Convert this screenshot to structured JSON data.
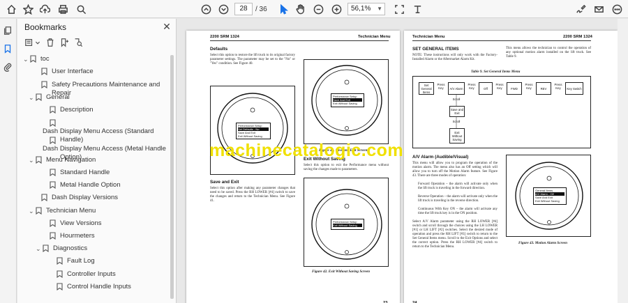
{
  "toolbar": {
    "page_current": "28",
    "page_total": "/ 36",
    "zoom": "56,1%"
  },
  "panel": {
    "title": "Bookmarks",
    "items": [
      {
        "label": "toc"
      },
      {
        "label": "User Interface"
      },
      {
        "label": "Safety Precautions Maintenance and Repair"
      },
      {
        "label": "General"
      },
      {
        "label": "Description"
      },
      {
        "label": "Dash Display Menu Access (Standard"
      },
      {
        "label": "Handle)"
      },
      {
        "label": "Dash Display Menu Access (Metal Handle"
      },
      {
        "label": "Option)"
      },
      {
        "label": "Menu Navigation"
      },
      {
        "label": "Standard Handle"
      },
      {
        "label": "Metal Handle Option"
      },
      {
        "label": "Dash Display Versions"
      },
      {
        "label": "Technician Menu"
      },
      {
        "label": "View Versions"
      },
      {
        "label": "Hourmeters"
      },
      {
        "label": "Diagnostics"
      },
      {
        "label": "Fault Log"
      },
      {
        "label": "Controller Inputs"
      },
      {
        "label": "Control Handle Inputs"
      }
    ]
  },
  "left_page": {
    "header_left": "2200 SRM 1324",
    "header_right": "Technician Menu",
    "h_defaults": "Defaults",
    "p_defaults": "Select this option to restore the lift truck to its original factory parameter settings. The parameter may be set to the \"No\" or \"Yes\" condition. See Figure 40.",
    "fig40_screen": [
      "Performance Setup",
      "Set Defaults - No",
      "Save And Exit",
      "Exit Without Saving"
    ],
    "fig41_screen": [
      "Performance Setup",
      "Save And Exit",
      "Exit Without Saving"
    ],
    "fig41_caption": "Figure 41. Save and Exit Screen",
    "h_exit": "Exit Without Saving",
    "p_exit": "Select this option to exit the Performance menu without saving the changes made to parameters.",
    "h_save": "Save and Exit",
    "p_save": "Select this option after making any parameter changes that need to be saved. Press the RH LOWER [#4] switch to save the changes and return to the Technician Menu. See Figure 41.",
    "fig42_screen": [
      "Performance Setup",
      "Exit Without Saving"
    ],
    "fig42_caption": "Figure 42. Exit Without Saving Screen",
    "footer": "23"
  },
  "right_page": {
    "header_left": "Technician Menu",
    "header_right": "2200 SRM 1324",
    "h_set": "SET GENERAL ITEMS",
    "note": "NOTE: These instructions will only work with the Factory-Installed Alarm or the Aftermarket Alarm Kit.",
    "p_set": "This menu allows the technician to control the operation of any optional motion alarm installed on the lift truck. See Table 9.",
    "table_title": "Table 9. Set General Items Menu",
    "table_boxes": [
      "Set General Items",
      "A/V Alarm",
      "Off",
      "FWD",
      "REV",
      "Key Switch",
      "Save and Exit",
      "Exit Without Saving"
    ],
    "table_labels": [
      "Press Key",
      "Press Key",
      "Press Key",
      "Press Key",
      "Press Key",
      "Scroll",
      "Scroll"
    ],
    "h_av": "A/V Alarm (Audible/Visual)",
    "p_av": "This menu will allow you to program the operation of the motion alarm. The menu also has an Off setting which will allow you to turn off the Motion Alarm feature. See Figure 43. There are three modes of operation:",
    "p_fwd": "Forward Operation – the alarm will activate only when the lift truck is traveling in the forward direction.",
    "p_rev": "Reverse Operation – the alarm will activate only when the lift truck is traveling in the reverse direction.",
    "p_cont": "Continuous With Key ON – the alarm will activate any time the lift truck key is in the ON position.",
    "p_select": "Select A/V Alarm parameter using the RH LOWER [#4] switch and scroll through the choices using the LH LOWER [#1] or LH LIFT [#2] switches. Select the desired mode of operation and press the RH LIFT [#3] switch to return to the Set General Items menu. Scroll to the Exit Options and select the correct option. Press the RH LOWER [#4] switch to return to the Technician Menu.",
    "fig43_screen": [
      "General Items",
      "A/V Alarm - Off",
      "Save And Exit",
      "Exit Without Saving"
    ],
    "fig43_caption": "Figure 43. Motion Alarm Screen",
    "footer": "24"
  },
  "watermark": "machinecatalogic.com"
}
